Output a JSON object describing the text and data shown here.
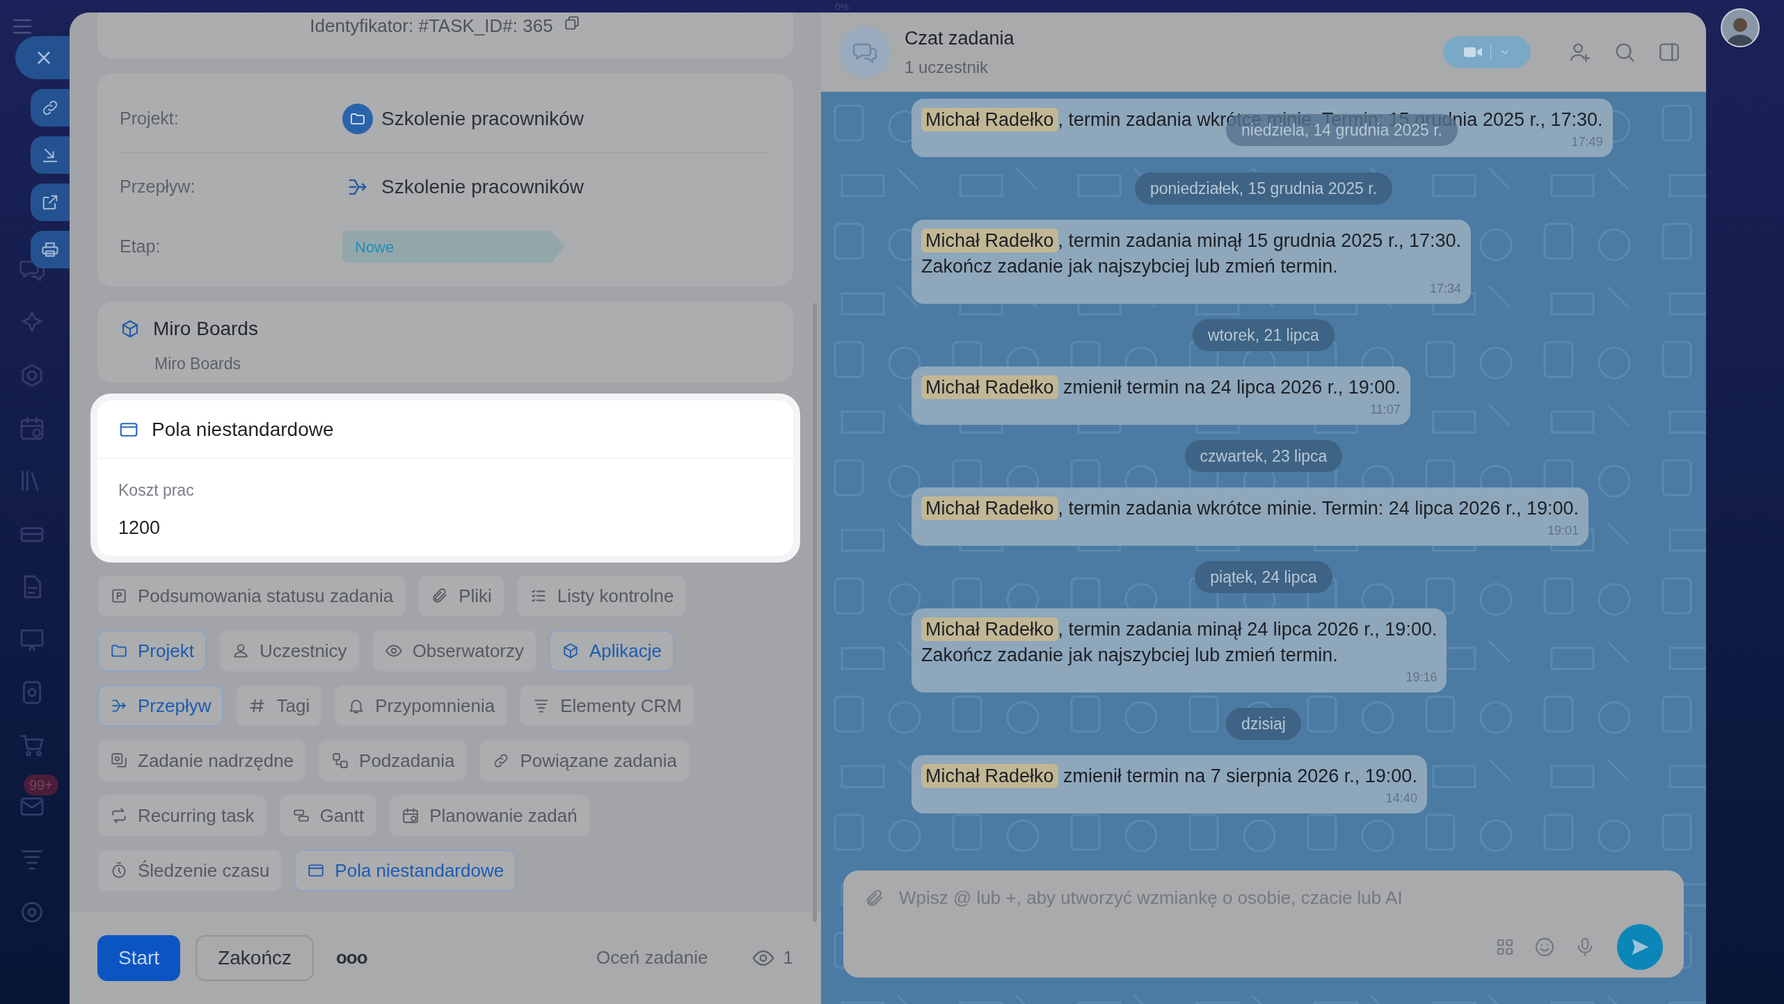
{
  "sidebar": {
    "badge": "99+"
  },
  "top_indicator": "0%",
  "task": {
    "identifier": "Identyfikator: #TASK_ID#: 365",
    "fields": [
      {
        "label": "Projekt:",
        "value": "Szkolenie pracowników",
        "kind": "project"
      },
      {
        "label": "Przepływ:",
        "value": "Szkolenie pracowników",
        "kind": "flow"
      },
      {
        "label": "Etap:",
        "value": "Nowe",
        "kind": "stage"
      }
    ],
    "app": {
      "title": "Miro Boards",
      "subtitle": "Miro Boards"
    },
    "custom_fields": {
      "title": "Pola niestandardowe",
      "label": "Koszt prac",
      "value": "1200"
    },
    "chips": [
      {
        "label": "Podsumowania statusu zadania",
        "selected": false
      },
      {
        "label": "Pliki",
        "selected": false
      },
      {
        "label": "Listy kontrolne",
        "selected": false
      },
      {
        "label": "Projekt",
        "selected": true
      },
      {
        "label": "Uczestnicy",
        "selected": false
      },
      {
        "label": "Obserwatorzy",
        "selected": false
      },
      {
        "label": "Aplikacje",
        "selected": true
      },
      {
        "label": "Przepływ",
        "selected": true
      },
      {
        "label": "Tagi",
        "selected": false
      },
      {
        "label": "Przypomnienia",
        "selected": false
      },
      {
        "label": "Elementy CRM",
        "selected": false
      },
      {
        "label": "Zadanie nadrzędne",
        "selected": false
      },
      {
        "label": "Podzadania",
        "selected": false
      },
      {
        "label": "Powiązane zadania",
        "selected": false
      },
      {
        "label": "Recurring task",
        "selected": false
      },
      {
        "label": "Gantt",
        "selected": false
      },
      {
        "label": "Planowanie zadań",
        "selected": false
      },
      {
        "label": "Śledzenie czasu",
        "selected": false
      },
      {
        "label": "Pola niestandardowe",
        "selected": true
      }
    ],
    "footer": {
      "primary": "Start",
      "secondary": "Zakończ",
      "more": "ooo",
      "rate": "Oceń zadanie",
      "views": "1"
    }
  },
  "chat": {
    "title": "Czat zadania",
    "subtitle": "1 uczestnik",
    "overlay_date": "niedziela, 14 grudnia 2025 r.",
    "timeline": [
      {
        "kind": "message",
        "author": "Michał Radełko",
        "text": ", termin zadania wkrótce minie. Termin: 15 grudnia 2025 r., 17:30.",
        "time": "17:49"
      },
      {
        "kind": "date",
        "text": "poniedziałek, 15 grudnia 2025 r."
      },
      {
        "kind": "message",
        "author": "Michał Radełko",
        "text": ", termin zadania minął 15 grudnia 2025 r., 17:30.\nZakończ zadanie jak najszybciej lub zmień termin.",
        "time": "17:34"
      },
      {
        "kind": "date",
        "text": "wtorek, 21 lipca"
      },
      {
        "kind": "message",
        "author": "Michał Radełko",
        "text": " zmienił termin na 24 lipca 2026 r., 19:00.",
        "time": "11:07"
      },
      {
        "kind": "date",
        "text": "czwartek, 23 lipca"
      },
      {
        "kind": "message",
        "author": "Michał Radełko",
        "text": ", termin zadania wkrótce minie. Termin: 24 lipca 2026 r., 19:00.",
        "time": "19:01"
      },
      {
        "kind": "date",
        "text": "piątek, 24 lipca"
      },
      {
        "kind": "message",
        "author": "Michał Radełko",
        "text": ", termin zadania minął 24 lipca 2026 r., 19:00.\nZakończ zadanie jak najszybciej lub zmień termin.",
        "time": "19:16"
      },
      {
        "kind": "date",
        "text": "dzisiaj"
      },
      {
        "kind": "message",
        "author": "Michał Radełko",
        "text": " zmienił termin na 7 sierpnia 2026 r., 19:00.",
        "time": "14:40"
      }
    ],
    "input": {
      "placeholder": "Wpisz @ lub +, aby utworzyć wzmiankę o osobie, czacie lub AI"
    }
  }
}
